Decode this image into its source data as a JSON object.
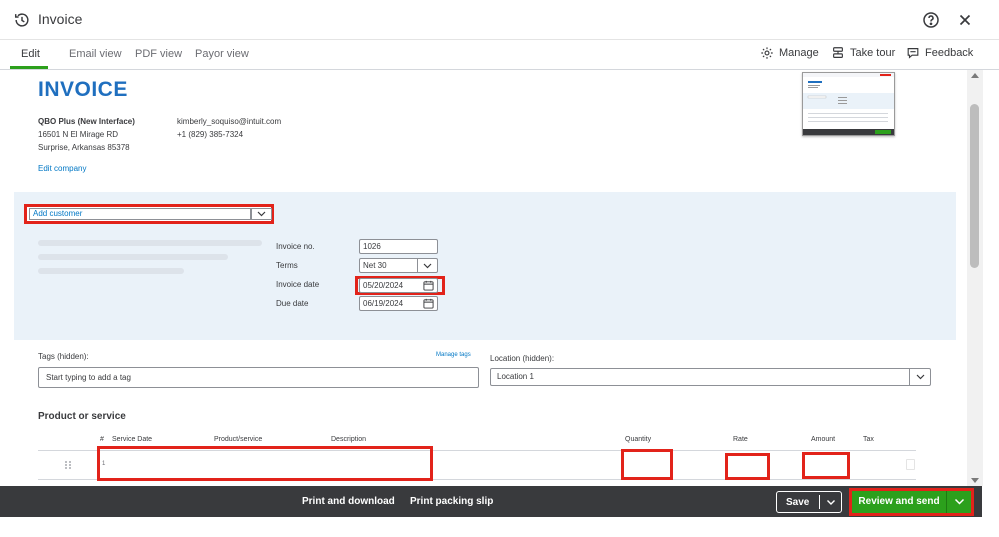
{
  "window": {
    "title": "Invoice",
    "history_icon": "history-icon",
    "help_icon": "question-circle-icon",
    "close_icon": "close-icon"
  },
  "tabs": [
    {
      "label": "Edit",
      "active": true
    },
    {
      "label": "Email view",
      "active": false
    },
    {
      "label": "PDF view",
      "active": false
    },
    {
      "label": "Payor view",
      "active": false
    }
  ],
  "toolbar_actions": {
    "manage": "Manage",
    "take_tour": "Take tour",
    "feedback": "Feedback"
  },
  "invoice": {
    "heading": "INVOICE",
    "company_name": "QBO Plus (New Interface)",
    "company_address_1": "16501 N El Mirage RD",
    "company_address_2": "Surprise, Arkansas 85378",
    "email": "kimberly_soquiso@intuit.com",
    "phone": "+1 (829) 385-7324",
    "edit_company": "Edit company"
  },
  "customer": {
    "placeholder": "Add customer"
  },
  "details": {
    "invoice_no_label": "Invoice no.",
    "invoice_no": "1026",
    "terms_label": "Terms",
    "terms": "Net 30",
    "invoice_date_label": "Invoice date",
    "invoice_date": "05/20/2024",
    "due_date_label": "Due date",
    "due_date": "06/19/2024"
  },
  "tags": {
    "label": "Tags (hidden):",
    "manage_link": "Manage tags",
    "placeholder": "Start typing to add a tag"
  },
  "location": {
    "label": "Location (hidden):",
    "value": "Location 1"
  },
  "products": {
    "title": "Product or service",
    "columns": {
      "num": "#",
      "service_date": "Service Date",
      "product": "Product/service",
      "description": "Description",
      "quantity": "Quantity",
      "rate": "Rate",
      "amount": "Amount",
      "tax": "Tax"
    },
    "rows": [
      {
        "num": "1"
      }
    ]
  },
  "footer": {
    "print_download": "Print and download",
    "print_slip": "Print packing slip",
    "save": "Save",
    "review_send": "Review and send"
  },
  "colors": {
    "brand_blue": "#1f6fbf",
    "link_blue": "#0077c5",
    "accent_green": "#2ca01c",
    "highlight_red": "#e2231a",
    "footer_dark": "#393a3d",
    "band_blue": "#eaf2f9"
  }
}
